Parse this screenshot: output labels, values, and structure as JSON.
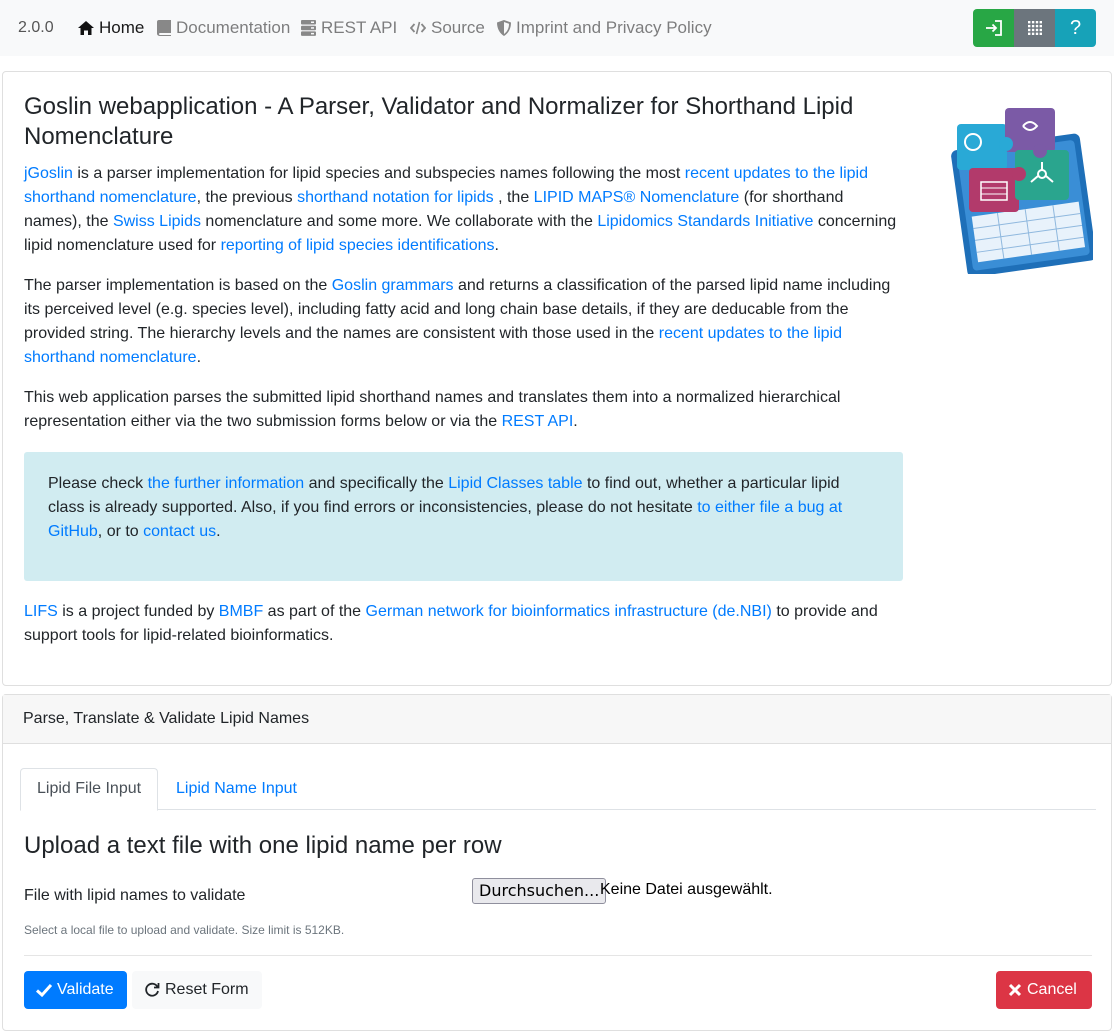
{
  "navbar": {
    "version": "2.0.0",
    "items": [
      {
        "label": "Home",
        "icon": "home-icon"
      },
      {
        "label": "Documentation",
        "icon": "book-icon"
      },
      {
        "label": "REST API",
        "icon": "server-icon"
      },
      {
        "label": "Source",
        "icon": "code-icon"
      },
      {
        "label": "Imprint and Privacy Policy",
        "icon": "shield-icon"
      }
    ],
    "buttons": [
      {
        "icon": "login-icon",
        "color": "#28a745"
      },
      {
        "icon": "grid-icon",
        "color": "#6c757d"
      },
      {
        "label": "?",
        "icon": "help-icon",
        "color": "#17a2b8"
      }
    ]
  },
  "intro": {
    "title": "Goslin webapplication - A Parser, Validator and Normalizer for Shorthand Lipid Nomenclature",
    "p1": {
      "jgoslin": "jGoslin",
      "t1": " is a parser implementation for lipid species and subspecies names following the most ",
      "link_recent": "recent updates to the lipid shorthand nomenclature",
      "t2": ", the previous ",
      "link_shorthand": "shorthand notation for lipids",
      "t3": " , the ",
      "link_lipidmaps": "LIPID MAPS® Nomenclature",
      "t4": " (for shorthand names), the ",
      "link_swiss": "Swiss Lipids",
      "t5": " nomenclature and some more. We collaborate with the ",
      "link_lsi": "Lipidomics Standards Initiative",
      "t6": " concerning lipid nomenclature used for ",
      "link_reporting": "reporting of lipid species identifications",
      "t7": "."
    },
    "p2": {
      "t1": "The parser implementation is based on the ",
      "link_grammars": "Goslin grammars",
      "t2": " and returns a classification of the parsed lipid name including its perceived level (e.g. species level), including fatty acid and long chain base details, if they are deducable from the provided string. The hierarchy levels and the names are consistent with those used in the ",
      "link_recent": "recent updates to the lipid shorthand nomenclature",
      "t3": "."
    },
    "p3": {
      "t1": "This web application parses the submitted lipid shorthand names and translates them into a normalized hierarchical representation either via the two submission forms below or via the ",
      "link_rest": "REST API",
      "t2": "."
    },
    "info": {
      "t1": "Please check ",
      "link_further": "the further information",
      "t2": " and specifically the ",
      "link_classes": "Lipid Classes table",
      "t3": " to find out, whether a particular lipid class is already supported. Also, if you find errors or inconsistencies, please do not hesitate ",
      "link_bug": "to either file a bug at GitHub",
      "t4": ", or to ",
      "link_contact": "contact us",
      "t5": "."
    },
    "p4": {
      "link_lifs": "LIFS",
      "t1": " is a project funded by ",
      "link_bmbf": "BMBF",
      "t2": " as part of the ",
      "link_denbi": "German network for bioinformatics infrastructure (de.NBI)",
      "t3": " to provide and support tools for lipid-related bioinformatics."
    }
  },
  "form": {
    "header": "Parse, Translate & Validate Lipid Names",
    "tabs": [
      "Lipid File Input",
      "Lipid Name Input"
    ],
    "upload_title": "Upload a text file with one lipid name per row",
    "field_label": "File with lipid names to validate",
    "browse_label": "Durchsuchen...",
    "file_status": "Keine Datei ausgewählt.",
    "help_text": "Select a local file to upload and validate. Size limit is 512KB.",
    "validate_label": "Validate",
    "reset_label": "Reset Form",
    "cancel_label": "Cancel"
  }
}
